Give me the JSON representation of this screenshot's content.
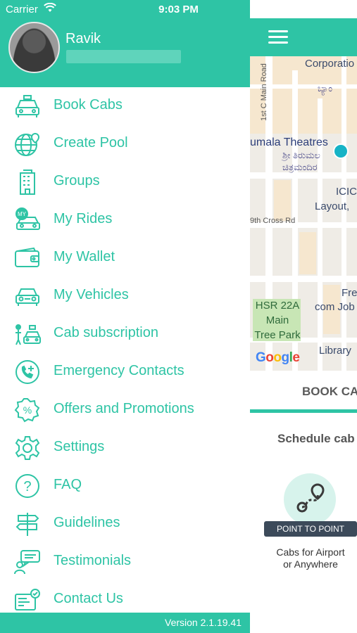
{
  "status_bar": {
    "carrier": "Carrier",
    "time": "9:03 PM",
    "icons": [
      "wifi-icon",
      "location-arrow-icon",
      "battery-icon",
      "charging-bolt-icon"
    ]
  },
  "drawer": {
    "user_name": "Ravik",
    "menu": [
      {
        "label": "Book Cabs",
        "icon": "taxi-icon"
      },
      {
        "label": "Create Pool",
        "icon": "globe-pin-icon"
      },
      {
        "label": "Groups",
        "icon": "building-icon"
      },
      {
        "label": "My Rides",
        "icon": "my-car-icon"
      },
      {
        "label": "My Wallet",
        "icon": "wallet-icon"
      },
      {
        "label": "My Vehicles",
        "icon": "vehicle-icon"
      },
      {
        "label": "Cab subscription",
        "icon": "subscription-icon"
      },
      {
        "label": "Emergency Contacts",
        "icon": "emergency-phone-icon"
      },
      {
        "label": "Offers and Promotions",
        "icon": "percent-badge-icon"
      },
      {
        "label": "Settings",
        "icon": "gear-icon"
      },
      {
        "label": "FAQ",
        "icon": "question-icon"
      },
      {
        "label": "Guidelines",
        "icon": "signpost-icon"
      },
      {
        "label": "Testimonials",
        "icon": "chat-person-icon"
      },
      {
        "label": "Contact Us",
        "icon": "contact-card-icon"
      }
    ],
    "version": "Version 2.1.19.41"
  },
  "main": {
    "map_labels": {
      "corporation": "Corporatio",
      "kannada_top": "ಬ್ಯಾಂ",
      "road_1": "1st C Main Road",
      "theatre": "umala Theatres",
      "theatre_kn1": "ಶ್ರೀ ತಿರುಮಲ",
      "theatre_kn2": "ಚಿತ್ರಮಂದಿರ",
      "icic": "ICIC",
      "layout": "Layout,",
      "cross_rd": "9th Cross Rd",
      "park1": "HSR 22A",
      "park2": "Main",
      "park3": "Tree Park",
      "fre": "Fre",
      "com_job": "com Job",
      "library": "Library",
      "google": "Google"
    },
    "book_tab": "BOOK CA",
    "schedule_title": "Schedule cab",
    "option_badge": "POINT TO POINT",
    "option_desc_1": "Cabs for Airport",
    "option_desc_2": "or Anywhere"
  },
  "colors": {
    "accent": "#2ec4a5",
    "badge": "#3c4a5a",
    "map_bg": "#efece6"
  }
}
